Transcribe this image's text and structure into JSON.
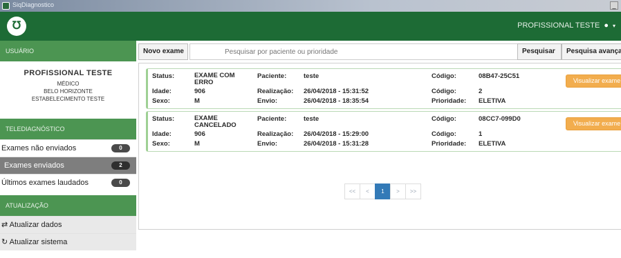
{
  "window": {
    "title": "SiqDiagnostico",
    "minimize": "_"
  },
  "header": {
    "logo": "℧",
    "user_name": "PROFISSIONAL TESTE",
    "caret": "▾",
    "user_icon": "user-icon"
  },
  "sidebar": {
    "user_section": "USUÁRIO",
    "profile": {
      "name": "PROFISSIONAL TESTE",
      "role": "MÉDICO",
      "city": "BELO HORIZONTE",
      "establishment": "ESTABELECIMENTO TESTE"
    },
    "telediag_section": "TELEDIAGNÓSTICO",
    "items": [
      {
        "label": "Exames não enviados",
        "count": "0"
      },
      {
        "label": "Exames enviados",
        "count": "2"
      },
      {
        "label": "Últimos exames laudados",
        "count": "0"
      }
    ],
    "update_section": "ATUALIZAÇÃO",
    "update_items": [
      {
        "label": "Atualizar dados",
        "icon": "⇄"
      },
      {
        "label": "Atualizar sistema",
        "icon": "↻"
      }
    ]
  },
  "toolbar": {
    "new_exam": "Novo exame",
    "search_placeholder": "Pesquisar por paciente ou prioridade",
    "search_button": "Pesquisar",
    "advanced_search": "Pesquisa avançada"
  },
  "labels": {
    "status": "Status:",
    "age": "Idade:",
    "sex": "Sexo:",
    "patient": "Paciente:",
    "performed": "Realização:",
    "sent": "Envio:",
    "code": "Código:",
    "priority": "Prioridade:"
  },
  "exams": [
    {
      "status": "EXAME COM ERRO",
      "age": "906",
      "sex": "M",
      "patient": "teste",
      "performed": "26/04/2018 - 15:31:52",
      "sent": "26/04/2018 - 18:35:54",
      "code_id": "08B47-25C51",
      "code": "2",
      "priority": "ELETIVA",
      "view_label": "Visualizar exame"
    },
    {
      "status": "EXAME CANCELADO",
      "age": "906",
      "sex": "M",
      "patient": "teste",
      "performed": "26/04/2018 - 15:29:00",
      "sent": "26/04/2018 - 15:31:28",
      "code_id": "08CC7-099D0",
      "code": "1",
      "priority": "ELETIVA",
      "view_label": "Visualizar exame"
    }
  ],
  "pagination": {
    "first": "<<",
    "prev": "<",
    "current": "1",
    "next": ">",
    "last": ">>"
  },
  "colors": {
    "brand_green": "#1d6b35",
    "section_green": "#4c9552",
    "view_button": "#f2ad4e",
    "page_active": "#337ab7"
  }
}
